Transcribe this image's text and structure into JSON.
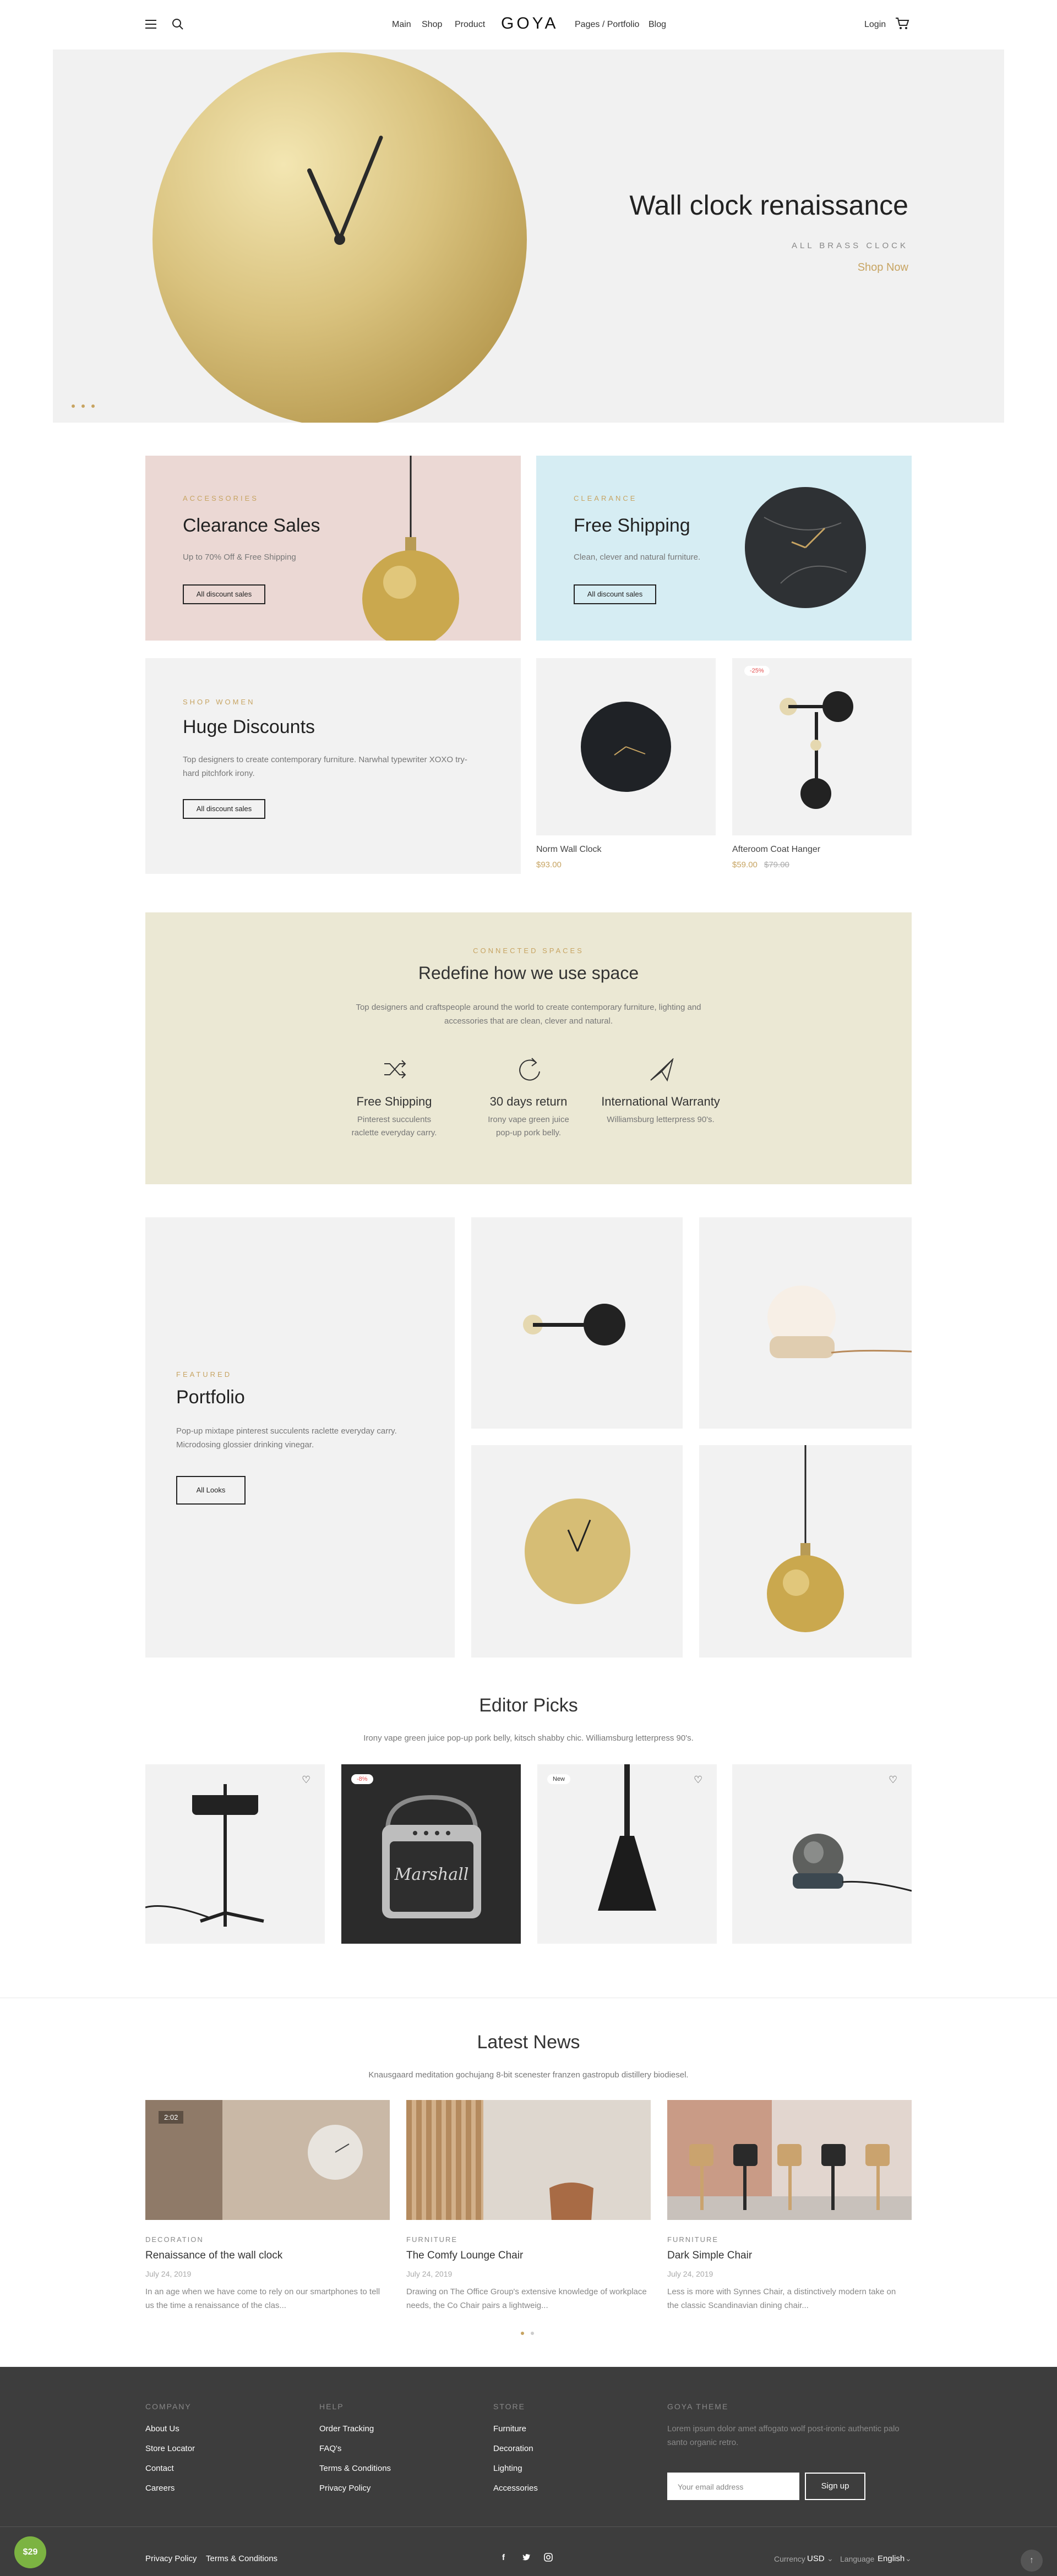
{
  "header": {
    "nav": [
      "Main",
      "Shop",
      "Product"
    ],
    "logo": "GOYA",
    "nav_right": [
      "Pages / Portfolio",
      "Blog"
    ],
    "login": "Login"
  },
  "hero": {
    "title": "Wall clock renaissance",
    "subtitle": "ALL BRASS CLOCK",
    "link": "Shop Now"
  },
  "promos": [
    {
      "eyebrow": "ACCESSORIES",
      "title": "Clearance Sales",
      "text": "Up to 70% Off & Free Shipping",
      "button": "All discount sales"
    },
    {
      "eyebrow": "CLEARANCE",
      "title": "Free Shipping",
      "text": "Clean, clever and natural furniture.",
      "button": "All discount sales"
    },
    {
      "eyebrow": "SHOP WOMEN",
      "title": "Huge Discounts",
      "text": "Top designers to create contemporary furniture. Narwhal typewriter XOXO try-hard pitchfork irony.",
      "button": "All discount sales"
    }
  ],
  "products": [
    {
      "name": "Norm Wall Clock",
      "price": "$93.00"
    },
    {
      "name": "Afteroom Coat Hanger",
      "price": "$59.00",
      "old_price": "$79.00",
      "badge": "-25%"
    }
  ],
  "connected": {
    "eyebrow": "CONNECTED SPACES",
    "title": "Redefine how we use space",
    "text": "Top designers and craftspeople around the world to create contemporary furniture, lighting and accessories that are clean, clever and natural.",
    "features": [
      {
        "icon": "shuffle-icon",
        "title": "Free Shipping",
        "text": "Pinterest succulents raclette everyday carry."
      },
      {
        "icon": "refresh-icon",
        "title": "30 days return",
        "text": "Irony vape green juice pop-up pork belly."
      },
      {
        "icon": "plane-icon",
        "title": "International Warranty",
        "text": "Williamsburg letterpress 90's."
      }
    ]
  },
  "portfolio": {
    "eyebrow": "FEATURED",
    "title": "Portfolio",
    "text": "Pop-up mixtape pinterest succulents raclette everyday carry. Microdosing glossier drinking vinegar.",
    "button": "All Looks"
  },
  "editor": {
    "title": "Editor Picks",
    "subtitle": "Irony vape green juice pop-up pork belly, kitsch shabby chic. Williamsburg letterpress 90's.",
    "badges": [
      "-8%",
      "New"
    ]
  },
  "news": {
    "title": "Latest News",
    "subtitle": "Knausgaard meditation gochujang 8-bit scenester franzen gastropub distillery biodiesel.",
    "posts": [
      {
        "category": "DECORATION",
        "title": "Renaissance of the wall clock",
        "date": "July 24, 2019",
        "text": "In an age when we have come to rely on our smartphones to tell us the time a renaissance of the clas...",
        "tag": "2:02"
      },
      {
        "category": "FURNITURE",
        "title": "The Comfy Lounge Chair",
        "date": "July 24, 2019",
        "text": "Drawing on The Office Group's extensive knowledge of workplace needs, the Co Chair pairs a lightweig..."
      },
      {
        "category": "FURNITURE",
        "title": "Dark Simple Chair",
        "date": "July 24, 2019",
        "text": "Less is more with Synnes Chair, a distinctively modern take on the classic Scandinavian dining chair..."
      }
    ]
  },
  "footer": {
    "company": {
      "head": "COMPANY",
      "links": [
        "About Us",
        "Store Locator",
        "Contact",
        "Careers"
      ]
    },
    "help": {
      "head": "HELP",
      "links": [
        "Order Tracking",
        "FAQ's",
        "Terms & Conditions",
        "Privacy Policy"
      ]
    },
    "store": {
      "head": "STORE",
      "links": [
        "Furniture",
        "Decoration",
        "Lighting",
        "Accessories"
      ]
    },
    "theme": {
      "head": "GOYA THEME",
      "text": "Lorem ipsum dolor amet affogato wolf post-ironic authentic palo santo organic retro."
    },
    "email_placeholder": "Your email address",
    "signup": "Sign up",
    "bottom_links": [
      "Privacy Policy",
      "Terms & Conditions"
    ],
    "currency_label": "Currency",
    "currency": "USD",
    "language_label": "Language",
    "language": "English",
    "price_badge": "$29"
  },
  "colors": {
    "accent": "#c7a462",
    "pink": "#ebd8d4",
    "blue": "#d6edf3",
    "olive": "#ebe8d4",
    "footer": "#3d3d3d"
  }
}
